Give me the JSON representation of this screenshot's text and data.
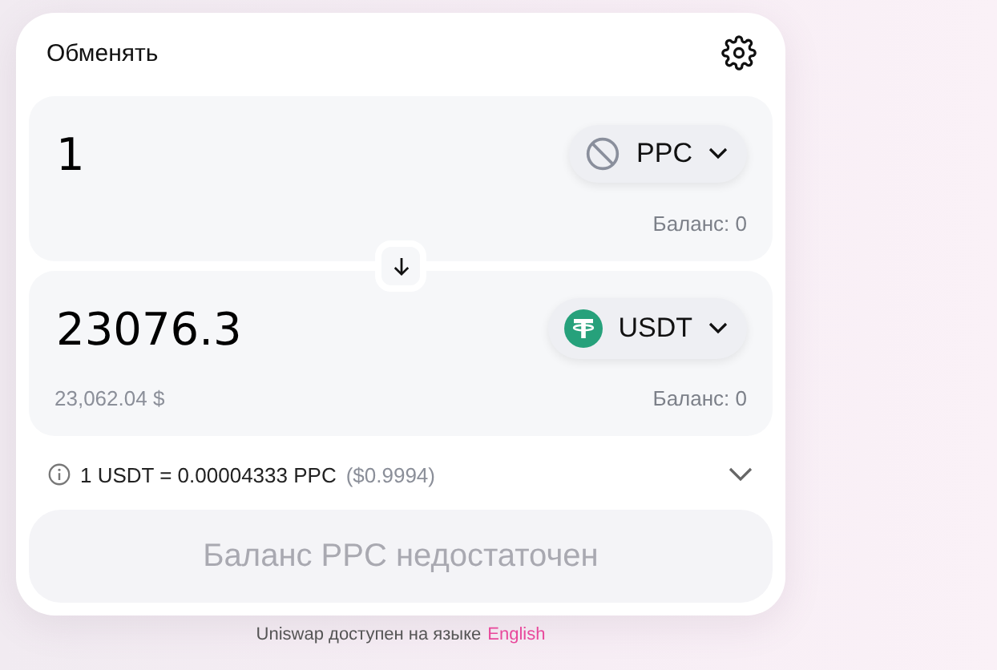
{
  "swap": {
    "title": "Обменять",
    "panels": [
      {
        "amount": "1",
        "token": {
          "symbol": "PPC",
          "kind": "unknown"
        },
        "balance": "Баланс: 0"
      },
      {
        "amount": "23076.3",
        "token": {
          "symbol": "USDT",
          "kind": "tether"
        },
        "usd_value": "23,062.04 $",
        "balance": "Баланс: 0"
      }
    ],
    "rate": {
      "text": "1 USDT = 0.00004333 PPC",
      "usd": "($0.9994)"
    },
    "submit": {
      "label": "Баланс PPC недостаточен",
      "disabled": true
    }
  },
  "footer": {
    "text": "Uniswap доступен на языке",
    "link": "English"
  }
}
